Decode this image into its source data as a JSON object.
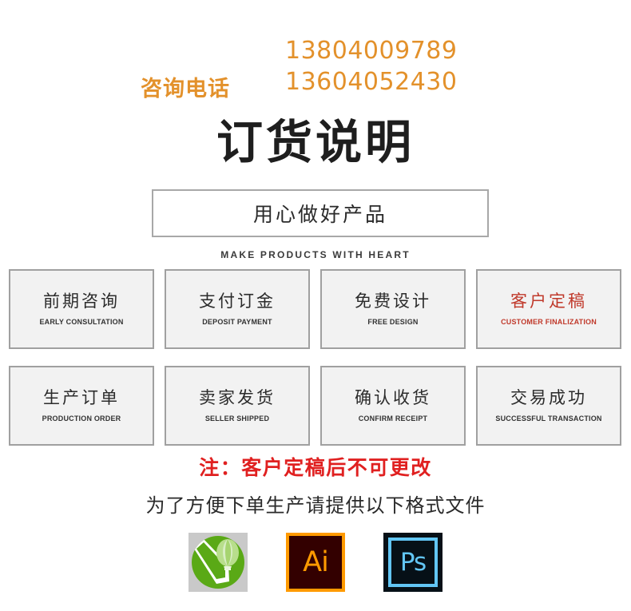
{
  "contact": {
    "label": "咨询电话",
    "phones": [
      "13804009789",
      "13604052430"
    ],
    "color": "#e3912b"
  },
  "title": "订货说明",
  "slogan": {
    "text": "用心做好产品",
    "subtitle": "MAKE PRODUCTS WITH HEART"
  },
  "steps": [
    {
      "cn": "前期咨询",
      "en": "EARLY CONSULTATION",
      "highlight": false
    },
    {
      "cn": "支付订金",
      "en": "DEPOSIT PAYMENT",
      "highlight": false
    },
    {
      "cn": "免费设计",
      "en": "FREE DESIGN",
      "highlight": false
    },
    {
      "cn": "客户定稿",
      "en": "CUSTOMER FINALIZATION",
      "highlight": true
    },
    {
      "cn": "生产订单",
      "en": "PRODUCTION ORDER",
      "highlight": false
    },
    {
      "cn": "卖家发货",
      "en": "SELLER SHIPPED",
      "highlight": false
    },
    {
      "cn": "确认收货",
      "en": "CONFIRM RECEIPT",
      "highlight": false
    },
    {
      "cn": "交易成功",
      "en": "SUCCESSFUL TRANSACTION",
      "highlight": false
    }
  ],
  "notes": {
    "warning": "注：客户定稿后不可更改",
    "request": "为了方便下单生产请提供以下格式文件",
    "warning_color": "#e02020",
    "highlight_color": "#c0392b"
  },
  "software": [
    {
      "name": "coreldraw-icon",
      "letters": ""
    },
    {
      "name": "illustrator-icon",
      "letters": "Ai"
    },
    {
      "name": "photoshop-icon",
      "letters": "Ps"
    }
  ]
}
